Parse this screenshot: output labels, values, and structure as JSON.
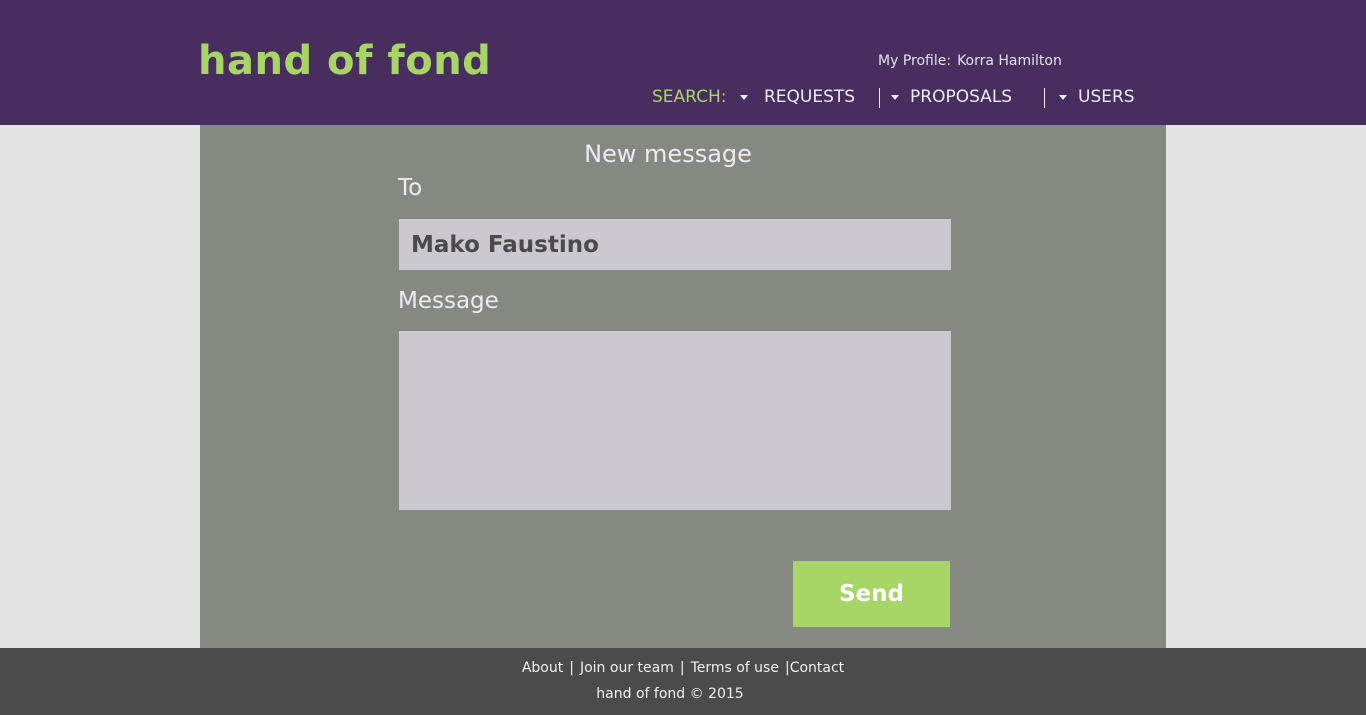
{
  "header": {
    "logo": "hand of fond",
    "profile_label": "My Profile:",
    "profile_name": "Korra Hamilton"
  },
  "nav": {
    "search_label": "SEARCH:",
    "items": [
      {
        "label": "REQUESTS"
      },
      {
        "label": "PROPOSALS"
      },
      {
        "label": "USERS"
      }
    ]
  },
  "form": {
    "title": "New message",
    "to_label": "To",
    "to_value": "Mako Faustino",
    "message_label": "Message",
    "message_value": "",
    "send_label": "Send"
  },
  "footer": {
    "links": [
      "About",
      "Join our team",
      "Terms of use",
      "Contact"
    ],
    "separator": "|",
    "copyright": "hand of fond © 2015"
  },
  "colors": {
    "header_bg": "#472e5e",
    "accent": "#a8d666",
    "panel_bg": "#868981",
    "input_bg": "#cbc9cf",
    "footer_bg": "#4b4b4b"
  }
}
